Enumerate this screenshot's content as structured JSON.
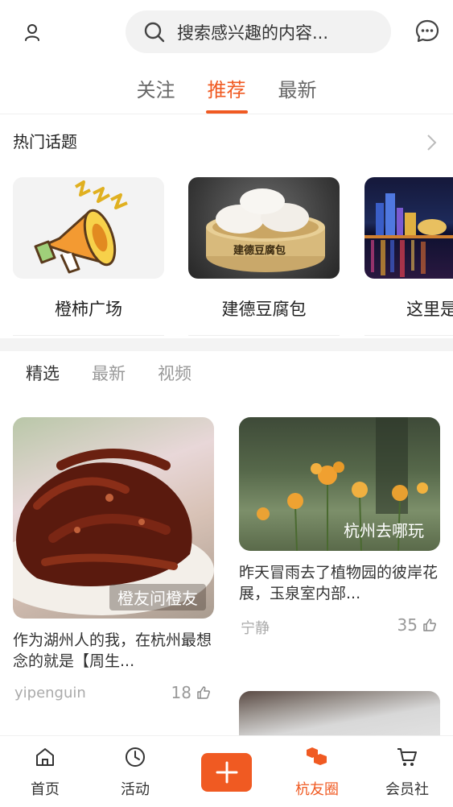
{
  "header": {
    "search_placeholder": "搜索感兴趣的内容...",
    "user_icon": "user-icon",
    "message_icon": "chat-bubble-icon"
  },
  "tabs": [
    {
      "label": "关注",
      "active": false
    },
    {
      "label": "推荐",
      "active": true
    },
    {
      "label": "最新",
      "active": false
    }
  ],
  "hot_topics": {
    "title": "热门话题",
    "items": [
      {
        "label": "橙柿广场"
      },
      {
        "label": "建德豆腐包",
        "stamp": "建德豆腐包"
      },
      {
        "label": "这里是杭"
      }
    ]
  },
  "sub_tabs": [
    {
      "label": "精选",
      "active": true
    },
    {
      "label": "最新",
      "active": false
    },
    {
      "label": "视频",
      "active": false
    }
  ],
  "feed": [
    {
      "tag": "橙友问橙友",
      "title": "作为湖州人的我，在杭州最想念的就是【周生...",
      "author": "yipenguin",
      "likes": "18"
    },
    {
      "tag": "杭州去哪玩",
      "title": "昨天冒雨去了植物园的彼岸花展，玉泉室内部...",
      "author": "宁静",
      "likes": "35"
    }
  ],
  "bottom_nav": [
    {
      "label": "首页",
      "icon": "home-icon",
      "active": false
    },
    {
      "label": "活动",
      "icon": "clock-icon",
      "active": false
    },
    {
      "label": "杭友圈",
      "icon": "cubes-icon",
      "active": true
    },
    {
      "label": "会员社",
      "icon": "cart-icon",
      "active": false
    }
  ],
  "colors": {
    "accent": "#f05a22",
    "background": "#ffffff",
    "search_bg": "#f2f2f2",
    "muted_text": "#999999"
  }
}
